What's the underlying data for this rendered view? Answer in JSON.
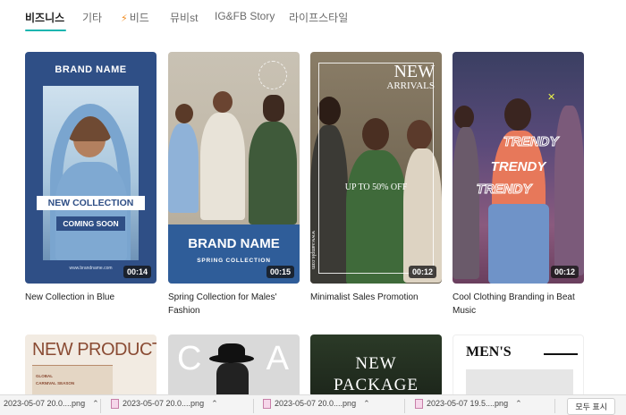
{
  "tabs": [
    {
      "label": "비즈니스",
      "active": true
    },
    {
      "label": "기타",
      "active": false
    },
    {
      "label": "비드",
      "active": false,
      "icon": "lightning-icon"
    },
    {
      "label": "뮤비st",
      "active": false
    },
    {
      "label": "IG&FB Story",
      "active": false
    },
    {
      "label": "라이프스타일",
      "active": false
    }
  ],
  "accent_color": "#19b5b0",
  "templates": [
    {
      "caption": "New Collection in Blue",
      "duration": "00:14",
      "brand": "BRAND NAME",
      "headline": "NEW COLLECTION",
      "subline": "COMING SOON",
      "url": "www.brandname.com",
      "bg": "#2f4f86"
    },
    {
      "caption": "Spring Collection for Males' Fashion",
      "duration": "00:15",
      "brand": "BRAND NAME",
      "subline": "SPRING COLLECTION",
      "bg": "#2f5d99"
    },
    {
      "caption": "Minimalist Sales Promotion",
      "duration": "00:12",
      "headline": "NEW",
      "subline": "ARRIVALS",
      "promo": "UP TO 50% OFF",
      "url": "www.sample.com"
    },
    {
      "caption": "Cool Clothing Branding in Beat Music",
      "duration": "00:12",
      "headline": "TRENDY"
    }
  ],
  "templates_row2": [
    {
      "headline": "NEW PRODUCTS",
      "line1": "GLOBAL",
      "line2": "CARNIVAL SEASON"
    },
    {
      "letters_left": "C",
      "letters_right": "A"
    },
    {
      "line1": "NEW",
      "line2": "PACKAGE"
    },
    {
      "headline": "MEN'S"
    }
  ],
  "downloads": [
    {
      "name": "2023-05-07 20.0....png"
    },
    {
      "name": "2023-05-07 20.0....png"
    },
    {
      "name": "2023-05-07 20.0....png"
    },
    {
      "name": "2023-05-07 19.5....png"
    }
  ],
  "show_all_label": "모두 표시"
}
